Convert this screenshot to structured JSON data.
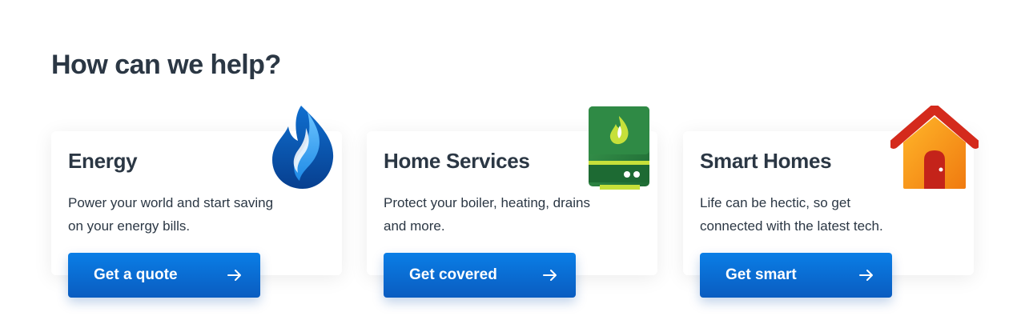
{
  "section": {
    "title": "How can we help?"
  },
  "cards": [
    {
      "title": "Energy",
      "description": "Power your world and start saving on your energy bills.",
      "button_label": "Get a quote",
      "icon": "flame-icon"
    },
    {
      "title": "Home Services",
      "description": "Protect your boiler, heating, drains and more.",
      "button_label": "Get covered",
      "icon": "boiler-icon"
    },
    {
      "title": "Smart Homes",
      "description": "Life can be hectic, so get connected with the latest tech.",
      "button_label": "Get smart",
      "icon": "house-icon"
    }
  ],
  "colors": {
    "heading": "#2b3744",
    "button": "#0a6fd6",
    "boiler_green": "#2e8b46",
    "flame_blue": "#0a5cc0",
    "house_orange": "#f79a1e",
    "roof_red": "#d42a1c"
  }
}
